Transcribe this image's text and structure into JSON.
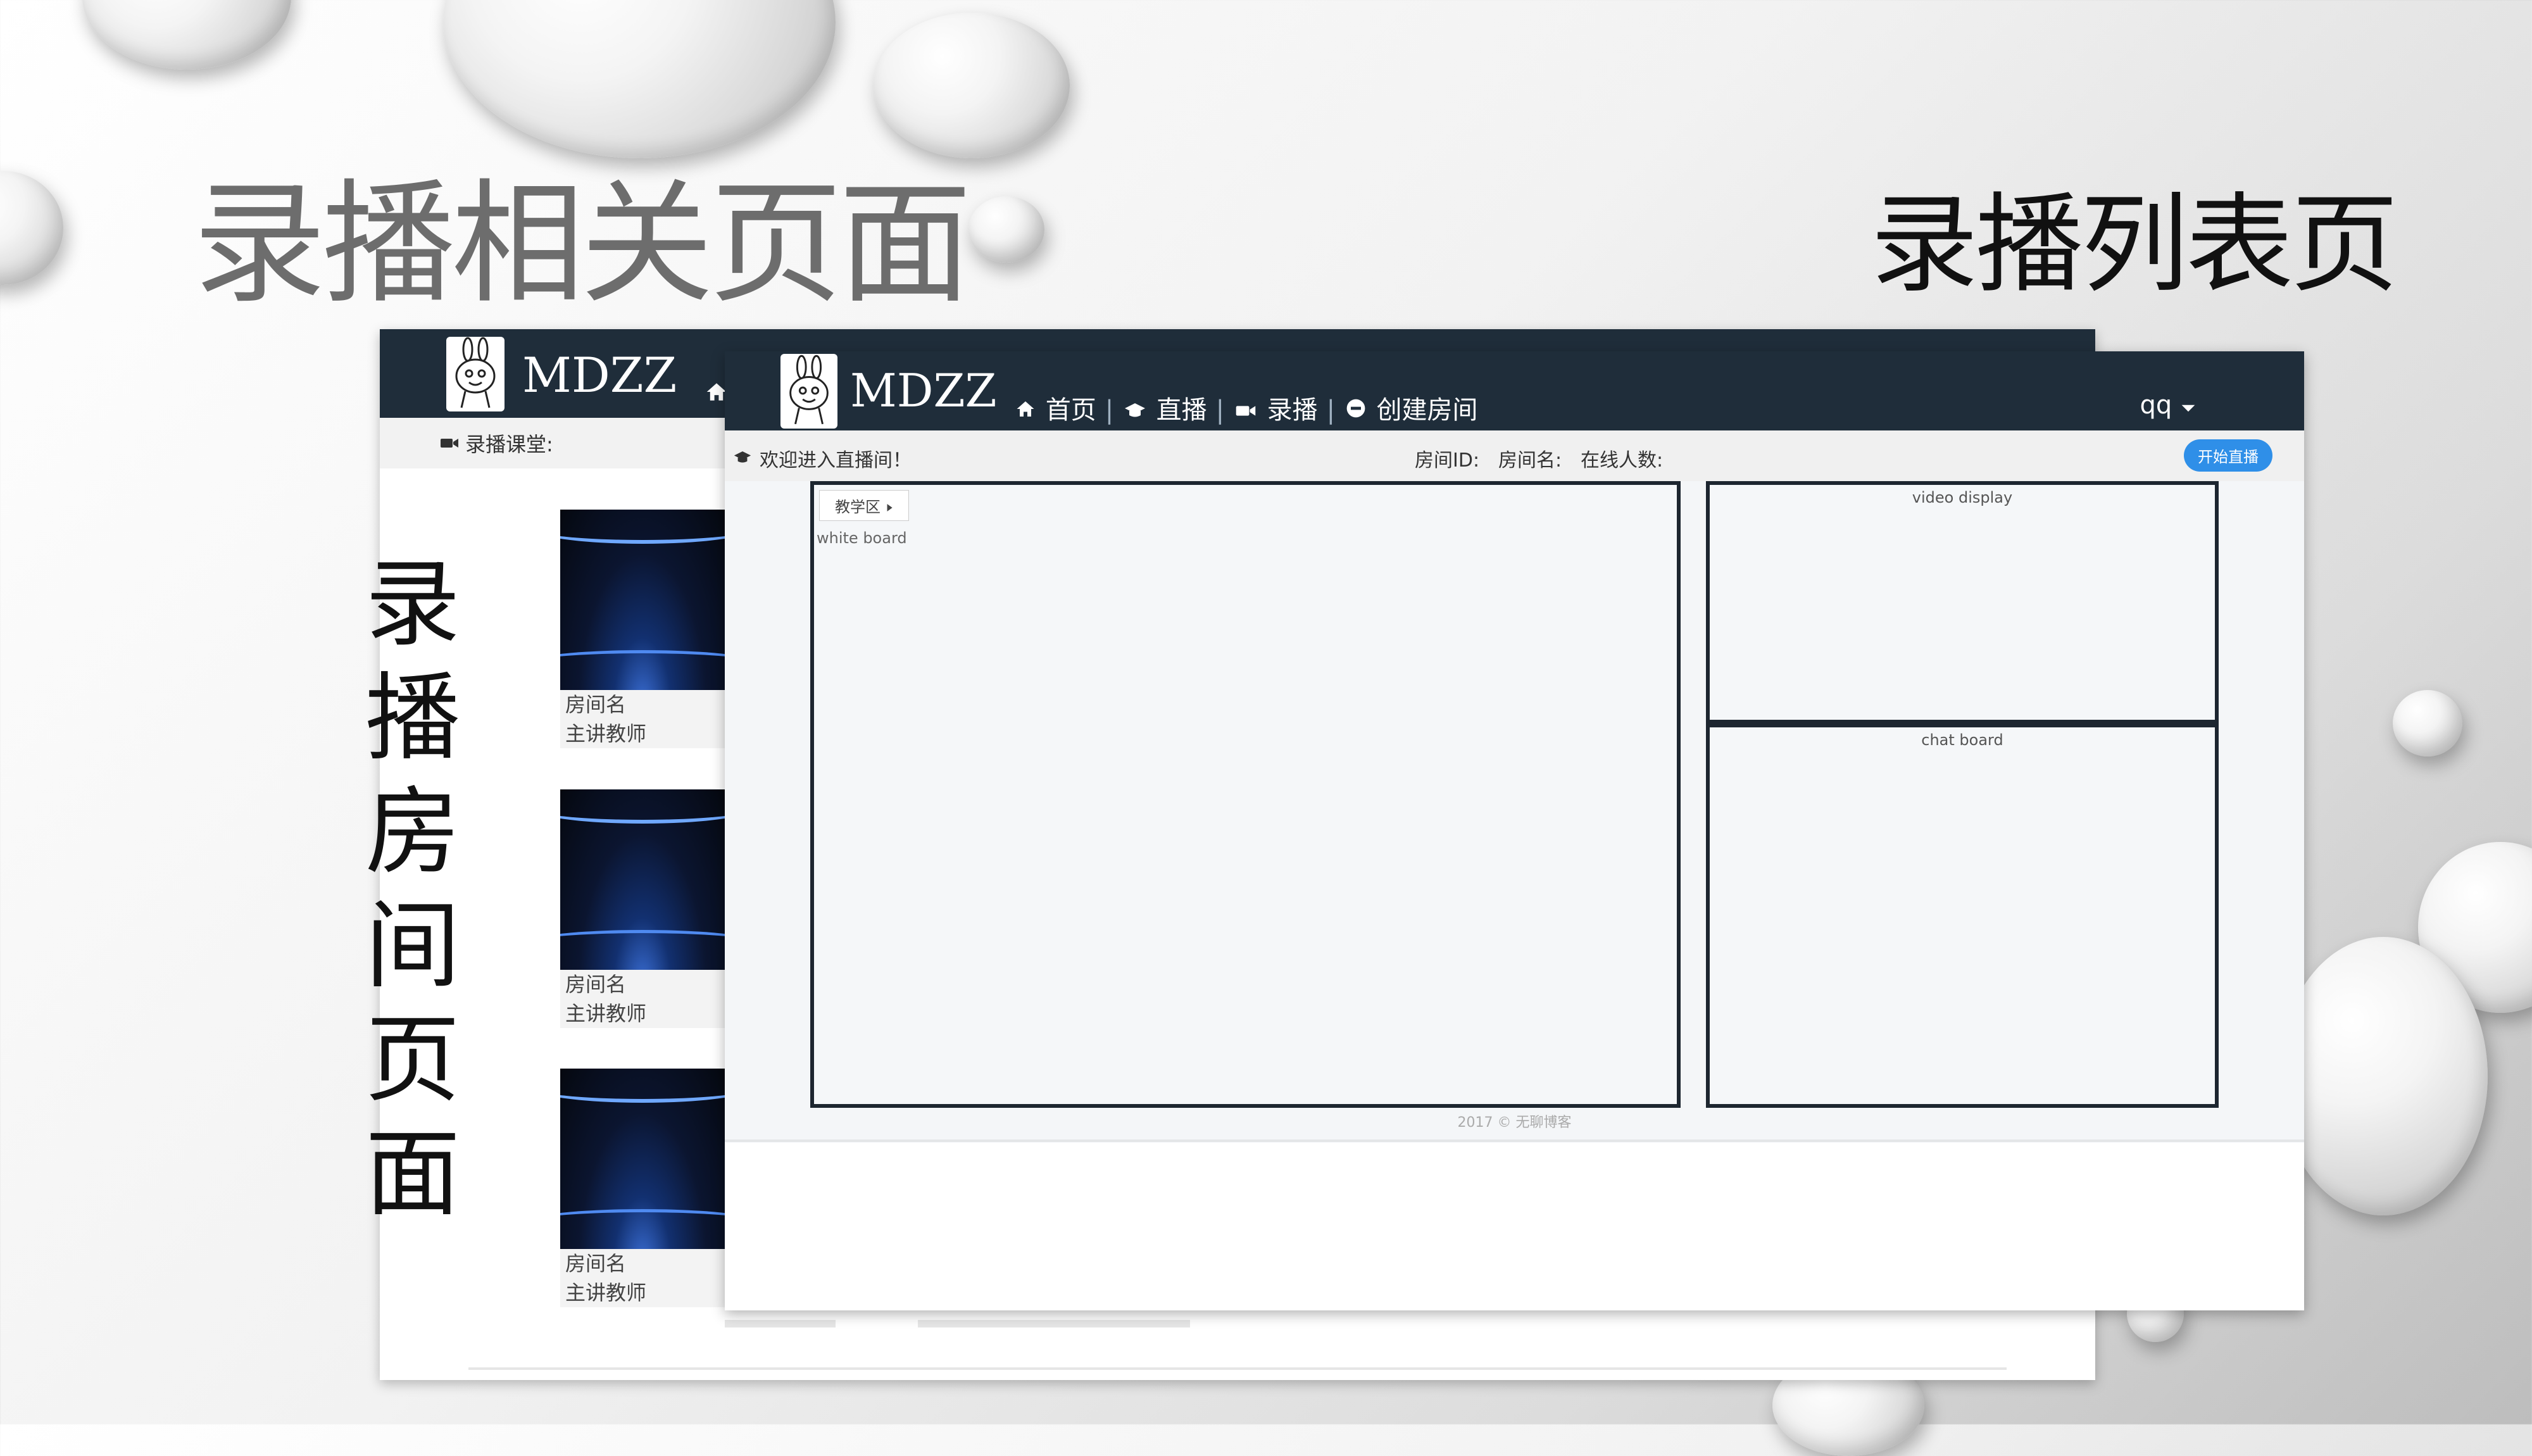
{
  "slide": {
    "title": "录播相关页面",
    "right_label": "录播列表页",
    "vertical_label": "录播房间页面"
  },
  "list_page": {
    "brand": "MDZZ",
    "section_title": "录播课堂:",
    "cards": [
      {
        "room_name": "房间名",
        "teacher": "主讲教师"
      },
      {
        "room_name": "房间名",
        "teacher": "主讲教师"
      },
      {
        "room_name": "房间名",
        "teacher": "主讲教师"
      }
    ]
  },
  "room_page": {
    "brand": "MDZZ",
    "nav": {
      "home": "首页",
      "live": "直播",
      "recorded": "录播",
      "create_room": "创建房间"
    },
    "user": "qq",
    "welcome": "欢迎进入直播间！",
    "room_id_label": "房间ID:",
    "room_name_label": "房间名:",
    "online_label": "在线人数:",
    "start_button": "开始直播",
    "teaching_tab": "教学区",
    "whiteboard_label": "white board",
    "video_label": "video display",
    "chat_label": "chat board",
    "footer": "2017 © 无聊博客"
  }
}
